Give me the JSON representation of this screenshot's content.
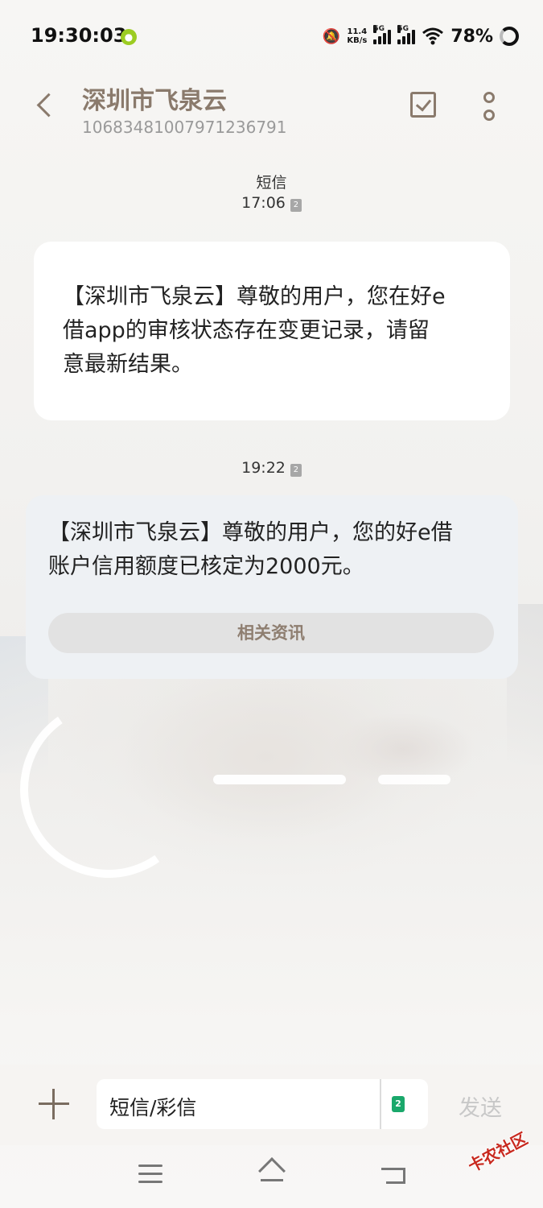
{
  "status_bar": {
    "time": "19:30:03",
    "net_speed_value": "11.4",
    "net_speed_unit": "KB/s",
    "sim1_type": "5G",
    "sim2_type": "5G",
    "battery": "78%"
  },
  "header": {
    "contact_name": "深圳市飞泉云",
    "contact_number": "1068348100797123679​1"
  },
  "messages": [
    {
      "label": "短信",
      "time": "17:06",
      "sim": "2",
      "text_line1": "【深圳市飞泉云】尊敬的用户，您在好e",
      "text_line2": "借app的审核状态存在变更记录，请留",
      "text_line3": "意最新结果。"
    },
    {
      "time": "19:22",
      "sim": "2",
      "text_line1": "【深圳市飞泉云】尊敬的用户，您的好e借",
      "text_line2": "账户信用额度已核定为2000元。",
      "related_label": "相关资讯"
    }
  ],
  "composer": {
    "placeholder": "短信/彩信",
    "sim": "2",
    "send_label": "发送"
  },
  "watermark": "卡农社区",
  "colors": {
    "accent": "#8a7a6c",
    "bubble_incoming": "#ffffff",
    "bubble_card": "#eef1f4",
    "sim_green": "#1aa86b"
  }
}
